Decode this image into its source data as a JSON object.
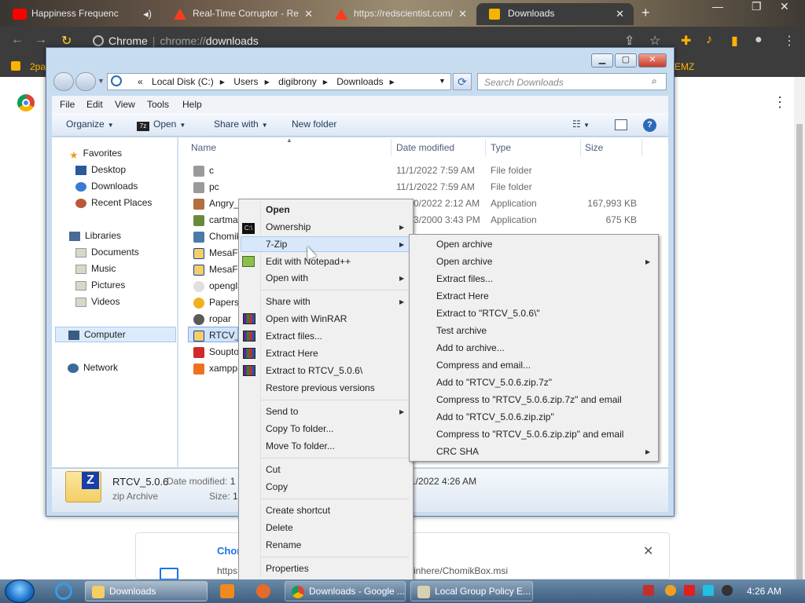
{
  "chrome": {
    "tabs": [
      {
        "title": "Happiness Frequenc",
        "icon": "youtube-icon",
        "color": "#ff0000"
      },
      {
        "title": "Real-Time Corruptor - Re",
        "icon": "triangle-icon",
        "color": "#ff3b1f"
      },
      {
        "title": "https://redscientist.com/",
        "icon": "triangle-icon",
        "color": "#ff3b1f"
      },
      {
        "title": "Downloads",
        "icon": "download-icon",
        "color": "#f4b400"
      }
    ],
    "new_tab": "+",
    "omnibox": {
      "host": "Chrome",
      "separator": "|",
      "scheme": "chrome://",
      "path": "downloads"
    },
    "bookmark_left": "2pa",
    "bookmark_right": "EMZ"
  },
  "downloads_page": {
    "item_name": "Chom",
    "item_url_prefix": "https",
    "item_url_suffix": "inhere/ChomikBox.msi",
    "close": "✕"
  },
  "explorer": {
    "address": {
      "prefix": "«",
      "crumbs": [
        "Local Disk (C:)",
        "Users",
        "digibrony",
        "Downloads"
      ],
      "search_placeholder": "Search Downloads"
    },
    "menu": [
      "File",
      "Edit",
      "View",
      "Tools",
      "Help"
    ],
    "commands": [
      {
        "label": "Organize",
        "dropdown": true
      },
      {
        "label": "Open",
        "dropdown": true
      },
      {
        "label": "Share with",
        "dropdown": true
      },
      {
        "label": "New folder",
        "dropdown": false
      }
    ],
    "nav": {
      "favorites": {
        "label": "Favorites",
        "items": [
          "Desktop",
          "Downloads",
          "Recent Places"
        ]
      },
      "libraries": {
        "label": "Libraries",
        "items": [
          "Documents",
          "Music",
          "Pictures",
          "Videos"
        ]
      },
      "computer": "Computer",
      "network": "Network"
    },
    "columns": {
      "name": "Name",
      "date": "Date modified",
      "type": "Type",
      "size": "Size"
    },
    "files": [
      {
        "name": "c",
        "date": "11/1/2022 7:59 AM",
        "type": "File folder",
        "size": ""
      },
      {
        "name": "pc",
        "date": "11/1/2022 7:59 AM",
        "type": "File folder",
        "size": ""
      },
      {
        "name": "Angry_",
        "date": "0/2022 2:12 AM",
        "type": "Application",
        "size": "167,993 KB"
      },
      {
        "name": "cartma",
        "date": "3/2000 3:43 PM",
        "type": "Application",
        "size": "675 KB"
      },
      {
        "name": "Chomik",
        "date": "",
        "type": "",
        "size": ""
      },
      {
        "name": "MesaFo",
        "date": "",
        "type": "",
        "size": ""
      },
      {
        "name": "MesaFo",
        "date": "",
        "type": "",
        "size": ""
      },
      {
        "name": "opengl3",
        "date": "",
        "type": "",
        "size": ""
      },
      {
        "name": "PapersP",
        "date": "",
        "type": "",
        "size": ""
      },
      {
        "name": "ropar",
        "date": "",
        "type": "",
        "size": ""
      },
      {
        "name": "RTCV_5",
        "date": "",
        "type": "",
        "size": ""
      },
      {
        "name": "Souptoy",
        "date": "",
        "type": "",
        "size": ""
      },
      {
        "name": "xampp-",
        "date": "",
        "type": "",
        "size": ""
      }
    ],
    "details": {
      "name": "RTCV_5.0.6",
      "type": "zip Archive",
      "modified_label": "Date modified:",
      "modified_value": "1",
      "size_label": "Size:",
      "size_value": "18",
      "created_partial": "1/2022 4:26 AM"
    }
  },
  "context_menu": {
    "items": [
      {
        "label": "Open",
        "bold": true,
        "icon": "",
        "sub": false
      },
      {
        "label": "Ownership",
        "icon": "cmd-icon",
        "sub": true
      },
      {
        "label": "7-Zip",
        "icon": "",
        "sub": true,
        "highlight": true
      },
      {
        "label": "Edit with Notepad++",
        "icon": "notepad-icon",
        "sub": false
      },
      {
        "label": "Open with",
        "icon": "",
        "sub": true
      },
      {
        "label": "Share with",
        "icon": "",
        "sub": true
      },
      {
        "label": "Open with WinRAR",
        "icon": "winrar-icon",
        "sub": false
      },
      {
        "label": "Extract files...",
        "icon": "winrar-icon",
        "sub": false
      },
      {
        "label": "Extract Here",
        "icon": "winrar-icon",
        "sub": false
      },
      {
        "label": "Extract to RTCV_5.0.6\\",
        "icon": "winrar-icon",
        "sub": false
      },
      {
        "label": "Restore previous versions",
        "icon": "",
        "sub": false
      },
      {
        "label": "Send to",
        "icon": "",
        "sub": true
      },
      {
        "label": "Copy To folder...",
        "icon": "",
        "sub": false
      },
      {
        "label": "Move To folder...",
        "icon": "",
        "sub": false
      },
      {
        "label": "Cut",
        "icon": "",
        "sub": false
      },
      {
        "label": "Copy",
        "icon": "",
        "sub": false
      },
      {
        "label": "Create shortcut",
        "icon": "",
        "sub": false
      },
      {
        "label": "Delete",
        "icon": "",
        "sub": false
      },
      {
        "label": "Rename",
        "icon": "",
        "sub": false
      },
      {
        "label": "Properties",
        "icon": "",
        "sub": false
      }
    ]
  },
  "zip_submenu": {
    "items": [
      {
        "label": "Open archive",
        "sub": false
      },
      {
        "label": "Open archive",
        "sub": true
      },
      {
        "label": "Extract files...",
        "sub": false
      },
      {
        "label": "Extract Here",
        "sub": false
      },
      {
        "label": "Extract to \"RTCV_5.0.6\\\"",
        "sub": false
      },
      {
        "label": "Test archive",
        "sub": false
      },
      {
        "label": "Add to archive...",
        "sub": false
      },
      {
        "label": "Compress and email...",
        "sub": false
      },
      {
        "label": "Add to \"RTCV_5.0.6.zip.7z\"",
        "sub": false
      },
      {
        "label": "Compress to \"RTCV_5.0.6.zip.7z\" and email",
        "sub": false
      },
      {
        "label": "Add to \"RTCV_5.0.6.zip.zip\"",
        "sub": false
      },
      {
        "label": "Compress to \"RTCV_5.0.6.zip.zip\" and email",
        "sub": false
      },
      {
        "label": "CRC SHA",
        "sub": true
      }
    ]
  },
  "taskbar": {
    "buttons": [
      {
        "label": "Downloads",
        "icon": "explorer-folder-icon",
        "active": true
      },
      {
        "label": "Downloads - Google ...",
        "icon": "chrome-icon",
        "active": false
      },
      {
        "label": "Local Group Policy E...",
        "icon": "policy-icon",
        "active": false
      }
    ],
    "clock": "4:26 AM"
  }
}
